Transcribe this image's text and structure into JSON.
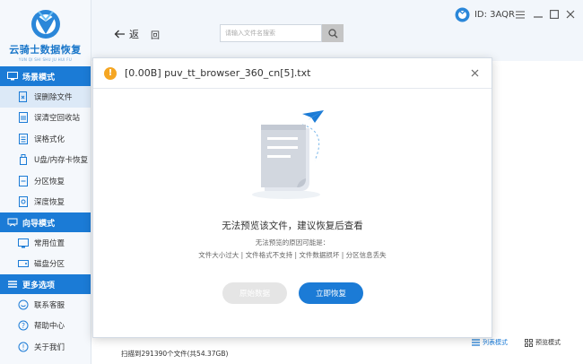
{
  "logo": {
    "title": "云骑士数据恢复",
    "subtitle": "YUN QI SHI SHU JU HUI FU"
  },
  "sidebar": {
    "sections": [
      {
        "header": "场景模式",
        "items": [
          "误删除文件",
          "误清空回收站",
          "误格式化",
          "U盘/内存卡恢复",
          "分区恢复",
          "深度恢复"
        ]
      },
      {
        "header": "向导模式",
        "items": [
          "常用位置",
          "磁盘分区"
        ]
      },
      {
        "header": "更多选项",
        "items": [
          "联系客服",
          "帮助中心",
          "关于我们"
        ]
      }
    ],
    "active_item": "误删除文件"
  },
  "topbar": {
    "back_label": "返",
    "forward_label": "回",
    "search_placeholder": "请输入文件名搜索",
    "account_id": "ID: 3AQR"
  },
  "status": {
    "scan_text": "扫描到291390个文件(共54.37GB)",
    "list_view_label": "列表模式",
    "preview_view_label": "预览模式"
  },
  "modal": {
    "title": "[0.00B] puv_tt_browser_360_cn[5].txt",
    "message": "无法预览该文件，建议恢复后查看",
    "reason_title": "无法预览的原因可能是：",
    "reasons": "文件大小过大 | 文件格式不支持 | 文件数据损坏 | 分区信息丢失",
    "btn_original": "原始数据",
    "btn_restore": "立即恢复"
  },
  "colors": {
    "accent": "#1b7bd6",
    "warning": "#f5a623"
  }
}
